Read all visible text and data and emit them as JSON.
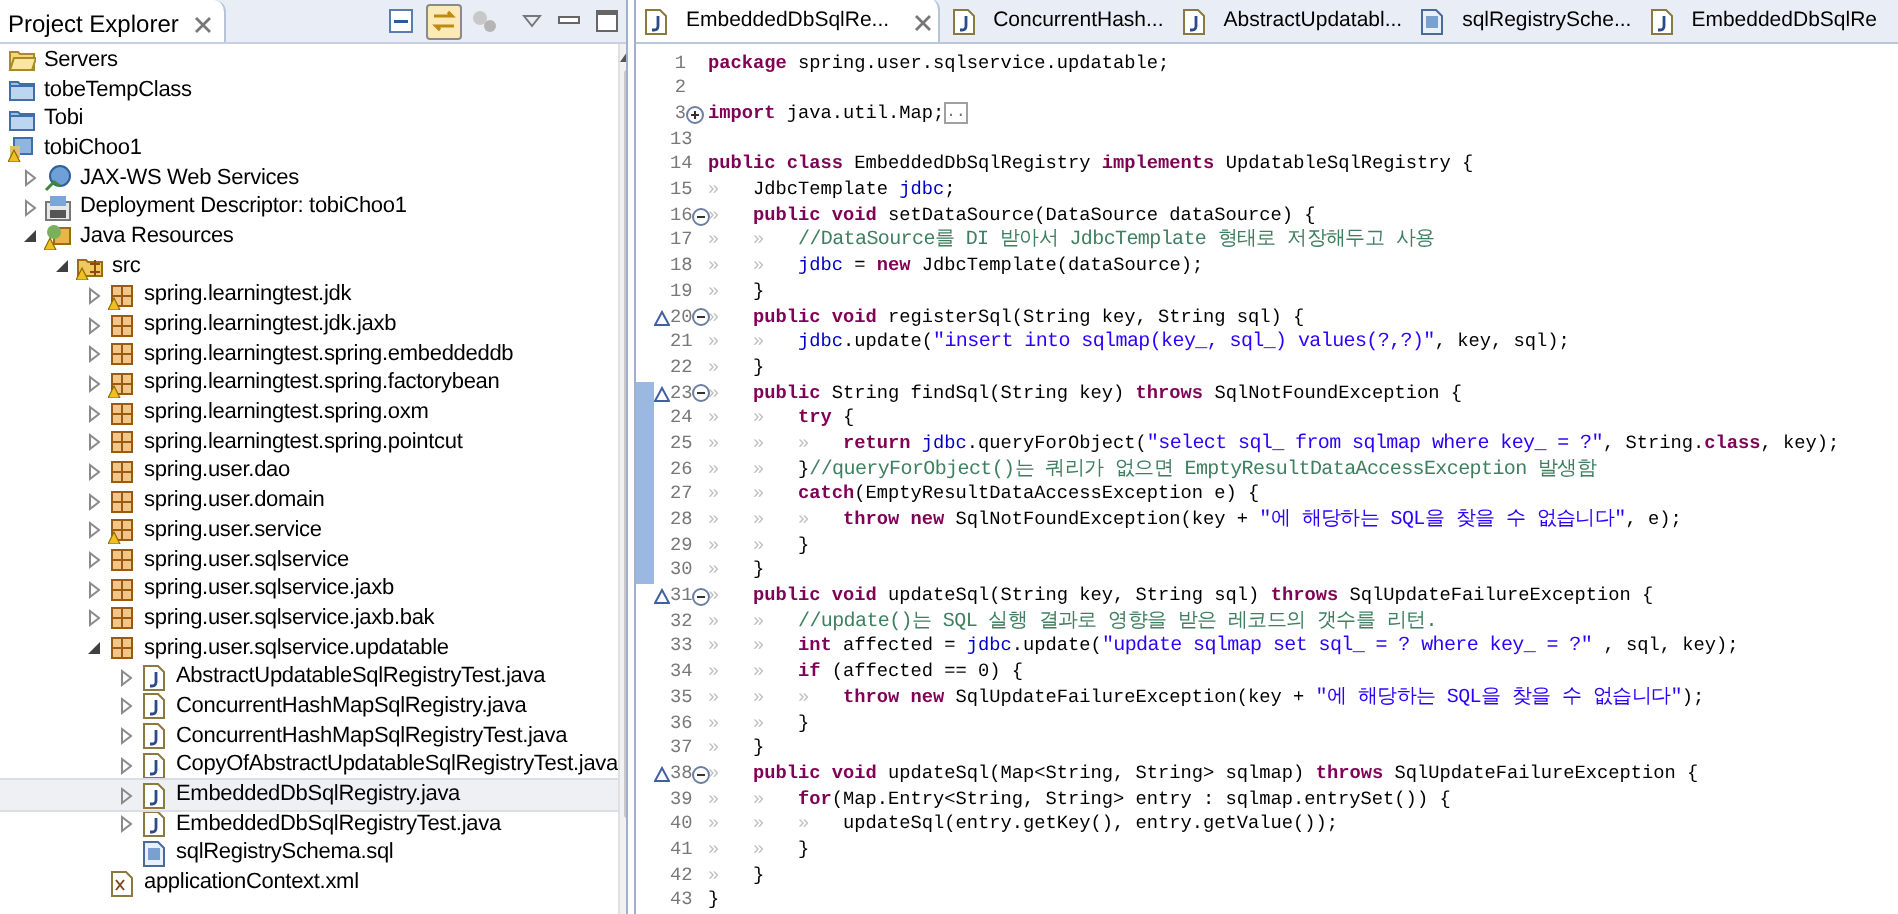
{
  "explorer": {
    "title": "Project Explorer",
    "items": [
      {
        "label": "Servers",
        "kind": "servers-folder",
        "warning": false,
        "selected": false
      },
      {
        "label": "tobeTempClass",
        "kind": "folder",
        "warning": false,
        "selected": false
      },
      {
        "label": "Tobi",
        "kind": "folder",
        "warning": false,
        "selected": false
      },
      {
        "label": "tobiChoo1",
        "kind": "project",
        "warning": true,
        "selected": false,
        "children": [
          {
            "label": "JAX-WS Web Services",
            "kind": "web-services",
            "warning": false,
            "selected": false,
            "expanded": false
          },
          {
            "label": "Deployment Descriptor: tobiChoo1",
            "kind": "descriptor",
            "warning": false,
            "selected": false,
            "expanded": false
          },
          {
            "label": "Java Resources",
            "kind": "java-resources",
            "warning": true,
            "selected": false,
            "expanded": true,
            "children": [
              {
                "label": "src",
                "kind": "source-folder",
                "warning": true,
                "selected": false,
                "expanded": true,
                "children": [
                  {
                    "label": "spring.learningtest.jdk",
                    "kind": "package",
                    "warning": true,
                    "selected": false,
                    "expanded": false
                  },
                  {
                    "label": "spring.learningtest.jdk.jaxb",
                    "kind": "package",
                    "warning": false,
                    "selected": false,
                    "expanded": false
                  },
                  {
                    "label": "spring.learningtest.spring.embeddeddb",
                    "kind": "package",
                    "warning": false,
                    "selected": false,
                    "expanded": false
                  },
                  {
                    "label": "spring.learningtest.spring.factorybean",
                    "kind": "package",
                    "warning": true,
                    "selected": false,
                    "expanded": false
                  },
                  {
                    "label": "spring.learningtest.spring.oxm",
                    "kind": "package",
                    "warning": false,
                    "selected": false,
                    "expanded": false
                  },
                  {
                    "label": "spring.learningtest.spring.pointcut",
                    "kind": "package",
                    "warning": false,
                    "selected": false,
                    "expanded": false
                  },
                  {
                    "label": "spring.user.dao",
                    "kind": "package",
                    "warning": false,
                    "selected": false,
                    "expanded": false
                  },
                  {
                    "label": "spring.user.domain",
                    "kind": "package",
                    "warning": false,
                    "selected": false,
                    "expanded": false
                  },
                  {
                    "label": "spring.user.service",
                    "kind": "package",
                    "warning": true,
                    "selected": false,
                    "expanded": false
                  },
                  {
                    "label": "spring.user.sqlservice",
                    "kind": "package",
                    "warning": false,
                    "selected": false,
                    "expanded": false
                  },
                  {
                    "label": "spring.user.sqlservice.jaxb",
                    "kind": "package",
                    "warning": false,
                    "selected": false,
                    "expanded": false
                  },
                  {
                    "label": "spring.user.sqlservice.jaxb.bak",
                    "kind": "package",
                    "warning": false,
                    "selected": false,
                    "expanded": false
                  },
                  {
                    "label": "spring.user.sqlservice.updatable",
                    "kind": "package",
                    "warning": false,
                    "selected": false,
                    "expanded": true,
                    "children": [
                      {
                        "label": "AbstractUpdatableSqlRegistryTest.java",
                        "kind": "java-file",
                        "warning": false,
                        "selected": false,
                        "expanded": false
                      },
                      {
                        "label": "ConcurrentHashMapSqlRegistry.java",
                        "kind": "java-file",
                        "warning": false,
                        "selected": false,
                        "expanded": false
                      },
                      {
                        "label": "ConcurrentHashMapSqlRegistryTest.java",
                        "kind": "java-file",
                        "warning": false,
                        "selected": false,
                        "expanded": false
                      },
                      {
                        "label": "CopyOfAbstractUpdatableSqlRegistryTest.java",
                        "kind": "java-file",
                        "warning": false,
                        "selected": false,
                        "expanded": false
                      },
                      {
                        "label": "EmbeddedDbSqlRegistry.java",
                        "kind": "java-file",
                        "warning": false,
                        "selected": true,
                        "expanded": false
                      },
                      {
                        "label": "EmbeddedDbSqlRegistryTest.java",
                        "kind": "java-file",
                        "warning": false,
                        "selected": false,
                        "expanded": false
                      },
                      {
                        "label": "sqlRegistrySchema.sql",
                        "kind": "sql-file",
                        "warning": false,
                        "selected": false
                      }
                    ]
                  },
                  {
                    "label": "applicationContext.xml",
                    "kind": "xml-file",
                    "warning": false,
                    "selected": false
                  }
                ]
              }
            ]
          }
        ]
      }
    ]
  },
  "editor": {
    "tabs": [
      {
        "label": "EmbeddedDbSqlRe...",
        "kind": "java-file",
        "selected": true
      },
      {
        "label": "ConcurrentHash...",
        "kind": "java-file",
        "selected": false
      },
      {
        "label": "AbstractUpdatabl...",
        "kind": "java-file",
        "selected": false
      },
      {
        "label": "sqlRegistrySche...",
        "kind": "sql-file",
        "selected": false
      },
      {
        "label": "EmbeddedDbSqlRe",
        "kind": "java-file",
        "selected": false
      }
    ],
    "lines": [
      {
        "number": "1",
        "override": false,
        "range_marker": false,
        "tokens": [
          {
            "kind": "keyword",
            "text": "package"
          },
          {
            "kind": "plain",
            "text": " spring.user.sqlservice.updatable;"
          }
        ]
      },
      {
        "number": "2",
        "override": false,
        "range_marker": false
      },
      {
        "number": "3",
        "collapsed": true,
        "override": false,
        "range_marker": false,
        "tokens": [
          {
            "kind": "keyword",
            "text": "import"
          },
          {
            "kind": "plain",
            "text": " java.util.Map;"
          },
          {
            "kind": "folded",
            "text": ".."
          }
        ]
      },
      {
        "number": "13",
        "override": false,
        "range_marker": false
      },
      {
        "number": "14",
        "override": false,
        "range_marker": false,
        "tokens": [
          {
            "kind": "keyword",
            "text": "public class"
          },
          {
            "kind": "plain",
            "text": " EmbeddedDbSqlRegistry "
          },
          {
            "kind": "keyword",
            "text": "implements"
          },
          {
            "kind": "plain",
            "text": " UpdatableSqlRegistry {"
          }
        ]
      },
      {
        "number": "15",
        "override": false,
        "range_marker": false,
        "tokens": [
          {
            "kind": "tab",
            "text": "»"
          },
          {
            "kind": "plain",
            "text": "JdbcTemplate "
          },
          {
            "kind": "field",
            "text": "jdbc"
          },
          {
            "kind": "plain",
            "text": ";"
          }
        ]
      },
      {
        "number": "16",
        "collapsed": false,
        "override": false,
        "range_marker": false,
        "tokens": [
          {
            "kind": "tab",
            "text": "»"
          },
          {
            "kind": "keyword",
            "text": "public void"
          },
          {
            "kind": "plain",
            "text": " setDataSource(DataSource dataSource) {"
          }
        ]
      },
      {
        "number": "17",
        "override": false,
        "range_marker": false,
        "tokens": [
          {
            "kind": "tab",
            "text": "»"
          },
          {
            "kind": "tab",
            "text": "»"
          },
          {
            "kind": "comment",
            "text": "//DataSource를 DI 받아서 JdbcTemplate 형태로 저장해두고 사용"
          }
        ]
      },
      {
        "number": "18",
        "override": false,
        "range_marker": false,
        "tokens": [
          {
            "kind": "tab",
            "text": "»"
          },
          {
            "kind": "tab",
            "text": "»"
          },
          {
            "kind": "field",
            "text": "jdbc"
          },
          {
            "kind": "plain",
            "text": " = "
          },
          {
            "kind": "keyword",
            "text": "new"
          },
          {
            "kind": "plain",
            "text": " JdbcTemplate(dataSource);"
          }
        ]
      },
      {
        "number": "19",
        "override": false,
        "range_marker": false,
        "tokens": [
          {
            "kind": "tab",
            "text": "»"
          },
          {
            "kind": "plain",
            "text": "}"
          }
        ]
      },
      {
        "number": "20",
        "collapsed": false,
        "override": true,
        "range_marker": false,
        "tokens": [
          {
            "kind": "tab",
            "text": "»"
          },
          {
            "kind": "keyword",
            "text": "public void"
          },
          {
            "kind": "plain",
            "text": " registerSql(String key, String sql) {"
          }
        ]
      },
      {
        "number": "21",
        "override": false,
        "range_marker": false,
        "tokens": [
          {
            "kind": "tab",
            "text": "»"
          },
          {
            "kind": "tab",
            "text": "»"
          },
          {
            "kind": "field",
            "text": "jdbc"
          },
          {
            "kind": "plain",
            "text": ".update("
          },
          {
            "kind": "string",
            "text": "\"insert into sqlmap(key_, sql_) values(?,?)\""
          },
          {
            "kind": "plain",
            "text": ", key, sql);"
          }
        ]
      },
      {
        "number": "22",
        "override": false,
        "range_marker": false,
        "tokens": [
          {
            "kind": "tab",
            "text": "»"
          },
          {
            "kind": "plain",
            "text": "}"
          }
        ]
      },
      {
        "number": "23",
        "collapsed": false,
        "override": true,
        "range_marker": true,
        "tokens": [
          {
            "kind": "tab",
            "text": "»"
          },
          {
            "kind": "keyword",
            "text": "public"
          },
          {
            "kind": "plain",
            "text": " String findSql(String key) "
          },
          {
            "kind": "keyword",
            "text": "throws"
          },
          {
            "kind": "plain",
            "text": " SqlNotFoundException {"
          }
        ]
      },
      {
        "number": "24",
        "override": false,
        "range_marker": true,
        "tokens": [
          {
            "kind": "tab",
            "text": "»"
          },
          {
            "kind": "tab",
            "text": "»"
          },
          {
            "kind": "keyword",
            "text": "try"
          },
          {
            "kind": "plain",
            "text": " {"
          }
        ]
      },
      {
        "number": "25",
        "override": false,
        "range_marker": true,
        "tokens": [
          {
            "kind": "tab",
            "text": "»"
          },
          {
            "kind": "tab",
            "text": "»"
          },
          {
            "kind": "tab",
            "text": "»"
          },
          {
            "kind": "keyword",
            "text": "return "
          },
          {
            "kind": "field",
            "text": "jdbc"
          },
          {
            "kind": "plain",
            "text": ".queryForObject("
          },
          {
            "kind": "string",
            "text": "\"select sql_ from sqlmap where key_ = ?\""
          },
          {
            "kind": "plain",
            "text": ", String."
          },
          {
            "kind": "keyword",
            "text": "class"
          },
          {
            "kind": "plain",
            "text": ", key);"
          }
        ]
      },
      {
        "number": "26",
        "override": false,
        "range_marker": true,
        "tokens": [
          {
            "kind": "tab",
            "text": "»"
          },
          {
            "kind": "tab",
            "text": "»"
          },
          {
            "kind": "plain",
            "text": "}"
          },
          {
            "kind": "comment",
            "text": "//queryForObject()는 쿼리가 없으면 EmptyResultDataAccessException 발생함"
          }
        ]
      },
      {
        "number": "27",
        "override": false,
        "range_marker": true,
        "tokens": [
          {
            "kind": "tab",
            "text": "»"
          },
          {
            "kind": "tab",
            "text": "»"
          },
          {
            "kind": "keyword",
            "text": "catch"
          },
          {
            "kind": "plain",
            "text": "(EmptyResultDataAccessException e) {"
          }
        ]
      },
      {
        "number": "28",
        "override": false,
        "range_marker": true,
        "tokens": [
          {
            "kind": "tab",
            "text": "»"
          },
          {
            "kind": "tab",
            "text": "»"
          },
          {
            "kind": "tab",
            "text": "»"
          },
          {
            "kind": "keyword",
            "text": "throw new"
          },
          {
            "kind": "plain",
            "text": " SqlNotFoundException(key + "
          },
          {
            "kind": "string",
            "text": "\"에 해당하는 SQL을 찾을 수 없습니다\""
          },
          {
            "kind": "plain",
            "text": ", e);"
          }
        ]
      },
      {
        "number": "29",
        "override": false,
        "range_marker": true,
        "tokens": [
          {
            "kind": "tab",
            "text": "»"
          },
          {
            "kind": "tab",
            "text": "»"
          },
          {
            "kind": "plain",
            "text": "}"
          }
        ]
      },
      {
        "number": "30",
        "override": false,
        "range_marker": true,
        "tokens": [
          {
            "kind": "tab",
            "text": "»"
          },
          {
            "kind": "plain",
            "text": "}"
          }
        ]
      },
      {
        "number": "31",
        "collapsed": false,
        "override": true,
        "range_marker": false,
        "tokens": [
          {
            "kind": "tab",
            "text": "»"
          },
          {
            "kind": "keyword",
            "text": "public void"
          },
          {
            "kind": "plain",
            "text": " updateSql(String key, String sql) "
          },
          {
            "kind": "keyword",
            "text": "throws"
          },
          {
            "kind": "plain",
            "text": " SqlUpdateFailureException {"
          }
        ]
      },
      {
        "number": "32",
        "override": false,
        "range_marker": false,
        "tokens": [
          {
            "kind": "tab",
            "text": "»"
          },
          {
            "kind": "tab",
            "text": "»"
          },
          {
            "kind": "comment",
            "text": "//update()는 SQL 실행 결과로 영향을 받은 레코드의 갯수를 리턴."
          }
        ]
      },
      {
        "number": "33",
        "override": false,
        "range_marker": false,
        "tokens": [
          {
            "kind": "tab",
            "text": "»"
          },
          {
            "kind": "tab",
            "text": "»"
          },
          {
            "kind": "keyword",
            "text": "int"
          },
          {
            "kind": "plain",
            "text": " affected = "
          },
          {
            "kind": "field",
            "text": "jdbc"
          },
          {
            "kind": "plain",
            "text": ".update("
          },
          {
            "kind": "string",
            "text": "\"update sqlmap set sql_ = ? where key_ = ?\""
          },
          {
            "kind": "plain",
            "text": " , sql, key);"
          }
        ]
      },
      {
        "number": "34",
        "override": false,
        "range_marker": false,
        "tokens": [
          {
            "kind": "tab",
            "text": "»"
          },
          {
            "kind": "tab",
            "text": "»"
          },
          {
            "kind": "keyword",
            "text": "if"
          },
          {
            "kind": "plain",
            "text": " (affected == 0) {"
          }
        ]
      },
      {
        "number": "35",
        "override": false,
        "range_marker": false,
        "tokens": [
          {
            "kind": "tab",
            "text": "»"
          },
          {
            "kind": "tab",
            "text": "»"
          },
          {
            "kind": "tab",
            "text": "»"
          },
          {
            "kind": "keyword",
            "text": "throw new"
          },
          {
            "kind": "plain",
            "text": " SqlUpdateFailureException(key + "
          },
          {
            "kind": "string",
            "text": "\"에 해당하는 SQL을 찾을 수 없습니다\""
          },
          {
            "kind": "plain",
            "text": ");"
          }
        ]
      },
      {
        "number": "36",
        "override": false,
        "range_marker": false,
        "tokens": [
          {
            "kind": "tab",
            "text": "»"
          },
          {
            "kind": "tab",
            "text": "»"
          },
          {
            "kind": "plain",
            "text": "}"
          }
        ]
      },
      {
        "number": "37",
        "override": false,
        "range_marker": false,
        "tokens": [
          {
            "kind": "tab",
            "text": "»"
          },
          {
            "kind": "plain",
            "text": "}"
          }
        ]
      },
      {
        "number": "38",
        "collapsed": false,
        "override": true,
        "range_marker": false,
        "tokens": [
          {
            "kind": "tab",
            "text": "»"
          },
          {
            "kind": "keyword",
            "text": "public void"
          },
          {
            "kind": "plain",
            "text": " updateSql(Map<String, String> sqlmap) "
          },
          {
            "kind": "keyword",
            "text": "throws"
          },
          {
            "kind": "plain",
            "text": " SqlUpdateFailureException {"
          }
        ]
      },
      {
        "number": "39",
        "override": false,
        "range_marker": false,
        "tokens": [
          {
            "kind": "tab",
            "text": "»"
          },
          {
            "kind": "tab",
            "text": "»"
          },
          {
            "kind": "keyword",
            "text": "for"
          },
          {
            "kind": "plain",
            "text": "(Map.Entry<String, String> entry : sqlmap.entrySet()) {"
          }
        ]
      },
      {
        "number": "40",
        "override": false,
        "range_marker": false,
        "tokens": [
          {
            "kind": "tab",
            "text": "»"
          },
          {
            "kind": "tab",
            "text": "»"
          },
          {
            "kind": "tab",
            "text": "»"
          },
          {
            "kind": "plain",
            "text": "updateSql(entry.getKey(), entry.getValue());"
          }
        ]
      },
      {
        "number": "41",
        "override": false,
        "range_marker": false,
        "tokens": [
          {
            "kind": "tab",
            "text": "»"
          },
          {
            "kind": "tab",
            "text": "»"
          },
          {
            "kind": "plain",
            "text": "}"
          }
        ]
      },
      {
        "number": "42",
        "override": false,
        "range_marker": false,
        "tokens": [
          {
            "kind": "tab",
            "text": "»"
          },
          {
            "kind": "plain",
            "text": "}"
          }
        ]
      },
      {
        "number": "43",
        "override": false,
        "range_marker": false,
        "tokens": [
          {
            "kind": "plain",
            "text": "}"
          }
        ]
      }
    ]
  }
}
